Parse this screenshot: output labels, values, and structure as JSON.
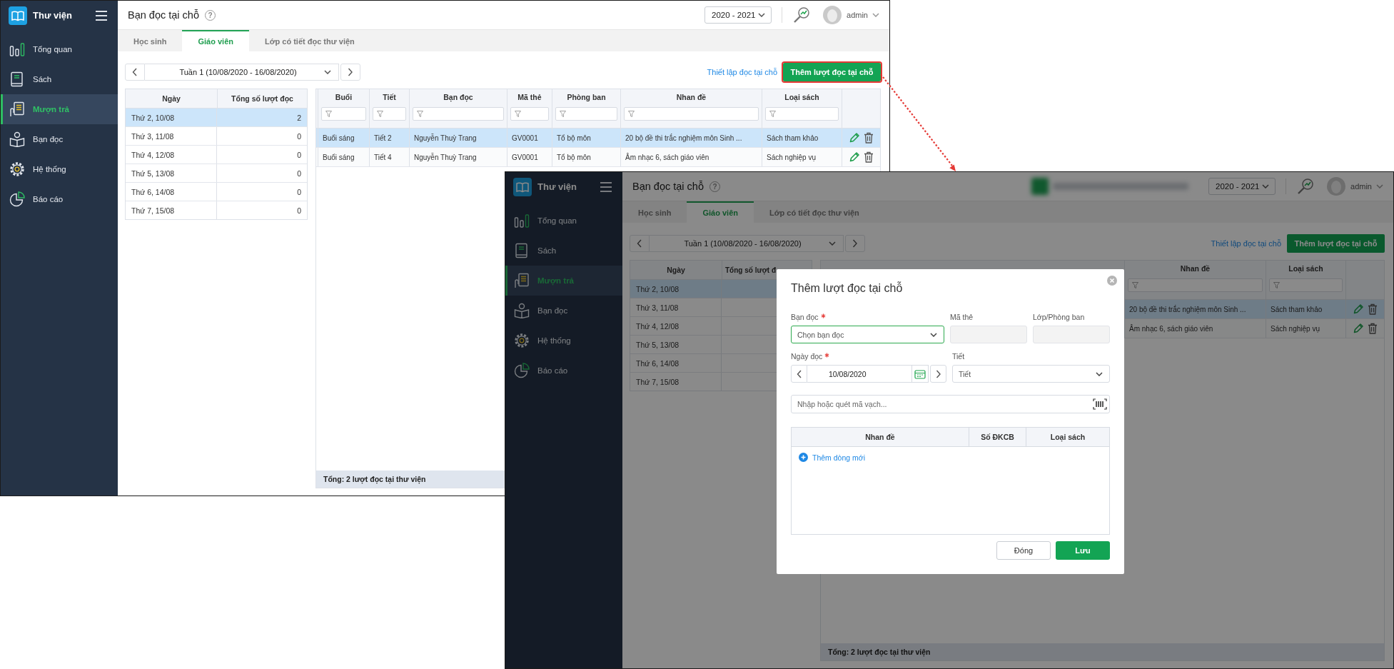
{
  "screens": [
    {
      "kind": "page",
      "app_title": "Thư viện",
      "menu": [
        {
          "label": "Tổng quan",
          "selected": false
        },
        {
          "label": "Sách",
          "selected": false
        },
        {
          "label": "Mượn trả",
          "selected": true
        },
        {
          "label": "Bạn đọc",
          "selected": false
        },
        {
          "label": "Hệ thống",
          "selected": false
        },
        {
          "label": "Báo cáo",
          "selected": false
        }
      ],
      "page_title": "Bạn đọc tại chỗ",
      "help_mark": "?",
      "year": "2020 - 2021",
      "user": "admin",
      "tabs": [
        {
          "label": "Học sinh",
          "selected": false
        },
        {
          "label": "Giáo viên",
          "selected": true
        },
        {
          "label": "Lớp có tiết đọc thư viện",
          "selected": false
        }
      ],
      "week": "Tuần 1 (10/08/2020 - 16/08/2020)",
      "setup_link": "Thiết lập đọc tại chỗ",
      "add_button": {
        "label": "Thêm lượt đọc tại chỗ",
        "highlighted": true
      },
      "days_table": {
        "columns": [
          "Ngày",
          "Tổng số lượt đọc"
        ],
        "rows": [
          {
            "cells": [
              "Thứ 2, 10/08",
              "2"
            ],
            "selected": true
          },
          {
            "cells": [
              "Thứ 3, 11/08",
              "0"
            ],
            "selected": false
          },
          {
            "cells": [
              "Thứ 4, 12/08",
              "0"
            ],
            "selected": false
          },
          {
            "cells": [
              "Thứ 5, 13/08",
              "0"
            ],
            "selected": false
          },
          {
            "cells": [
              "Thứ 6, 14/08",
              "0"
            ],
            "selected": false
          },
          {
            "cells": [
              "Thứ 7, 15/08",
              "0"
            ],
            "selected": false
          }
        ]
      },
      "readings_table": {
        "columns": [
          "Buổi",
          "Tiết",
          "Bạn đọc",
          "Mã thẻ",
          "Phòng ban",
          "Nhan đề",
          "Loại sách"
        ],
        "rows": [
          {
            "cells": [
              "Buổi sáng",
              "Tiết 2",
              "Nguyễn Thuỳ Trang",
              "GV0001",
              "Tổ bộ môn",
              "20 bộ đề thi trắc nghiệm môn Sinh ...",
              "Sách tham khảo"
            ],
            "selected": true
          },
          {
            "cells": [
              "Buổi sáng",
              "Tiết 4",
              "Nguyễn Thuỳ Trang",
              "GV0001",
              "Tổ bộ môn",
              "Âm nhạc 6, sách giáo viên",
              "Sách nghiệp vụ"
            ],
            "selected": false
          }
        ]
      },
      "footer": "Tổng: 2 lượt đọc tại thư viện"
    },
    {
      "kind": "page_with_dialog",
      "app_title": "Thư viện",
      "menu": [
        {
          "label": "Tổng quan",
          "selected": false
        },
        {
          "label": "Sách",
          "selected": false
        },
        {
          "label": "Mượn trả",
          "selected": true
        },
        {
          "label": "Bạn đọc",
          "selected": false
        },
        {
          "label": "Hệ thống",
          "selected": false
        },
        {
          "label": "Báo cáo",
          "selected": false
        }
      ],
      "page_title": "Bạn đọc tại chỗ",
      "help_mark": "?",
      "redacted_banner": true,
      "year": "2020 - 2021",
      "user": "admin",
      "tabs": [
        {
          "label": "Học sinh",
          "selected": false
        },
        {
          "label": "Giáo viên",
          "selected": true
        },
        {
          "label": "Lớp có tiết đọc thư viện",
          "selected": false
        }
      ],
      "week": "Tuần 1 (10/08/2020 - 16/08/2020)",
      "setup_link": "Thiết lập đọc tại chỗ",
      "add_button": {
        "label": "Thêm lượt đọc tại chỗ",
        "highlighted": false
      },
      "days_table": {
        "columns": [
          "Ngày",
          "Tổng số lượt đ"
        ],
        "rows": [
          {
            "cells": [
              "Thứ 2, 10/08"
            ],
            "selected": true
          },
          {
            "cells": [
              "Thứ 3, 11/08"
            ],
            "selected": false
          },
          {
            "cells": [
              "Thứ 4, 12/08"
            ],
            "selected": false
          },
          {
            "cells": [
              "Thứ 5, 13/08"
            ],
            "selected": false
          },
          {
            "cells": [
              "Thứ 6, 14/08"
            ],
            "selected": false
          },
          {
            "cells": [
              "Thứ 7, 15/08"
            ],
            "selected": false
          }
        ]
      },
      "readings_table": {
        "columns": [
          "Nhan đề",
          "Loại sách"
        ],
        "rows": [
          {
            "cells": [
              "20 bộ đề thi trắc nghiệm môn Sinh ...",
              "Sách tham khảo"
            ],
            "selected": true
          },
          {
            "cells": [
              "Âm nhạc 6, sách giáo viên",
              "Sách nghiệp vụ"
            ],
            "selected": false
          }
        ]
      },
      "footer": "Tổng: 2 lượt đọc tại thư viện",
      "dialog": {
        "title": "Thêm lượt đọc tại chỗ",
        "fields": [
          {
            "label": "Bạn đọc",
            "required": true,
            "kind": "select",
            "placeholder": "Chọn bạn đọc",
            "focused": true
          },
          {
            "label": "Mã thẻ",
            "required": false,
            "kind": "readonly"
          },
          {
            "label": "Lớp/Phòng ban",
            "required": false,
            "kind": "readonly"
          },
          {
            "label": "Ngày đọc",
            "required": true,
            "kind": "date",
            "value": "10/08/2020"
          },
          {
            "label": "Tiết",
            "required": false,
            "kind": "select",
            "placeholder": "Tiết",
            "focused": false
          }
        ],
        "barcode_placeholder": "Nhập hoặc quét mã vạch...",
        "table_columns": [
          "Nhan đề",
          "Số ĐKCB",
          "Loại sách"
        ],
        "add_row_link": "Thêm dòng mới",
        "buttons": [
          {
            "label": "Đóng",
            "kind": "secondary"
          },
          {
            "label": "Lưu",
            "kind": "primary"
          }
        ]
      }
    }
  ]
}
